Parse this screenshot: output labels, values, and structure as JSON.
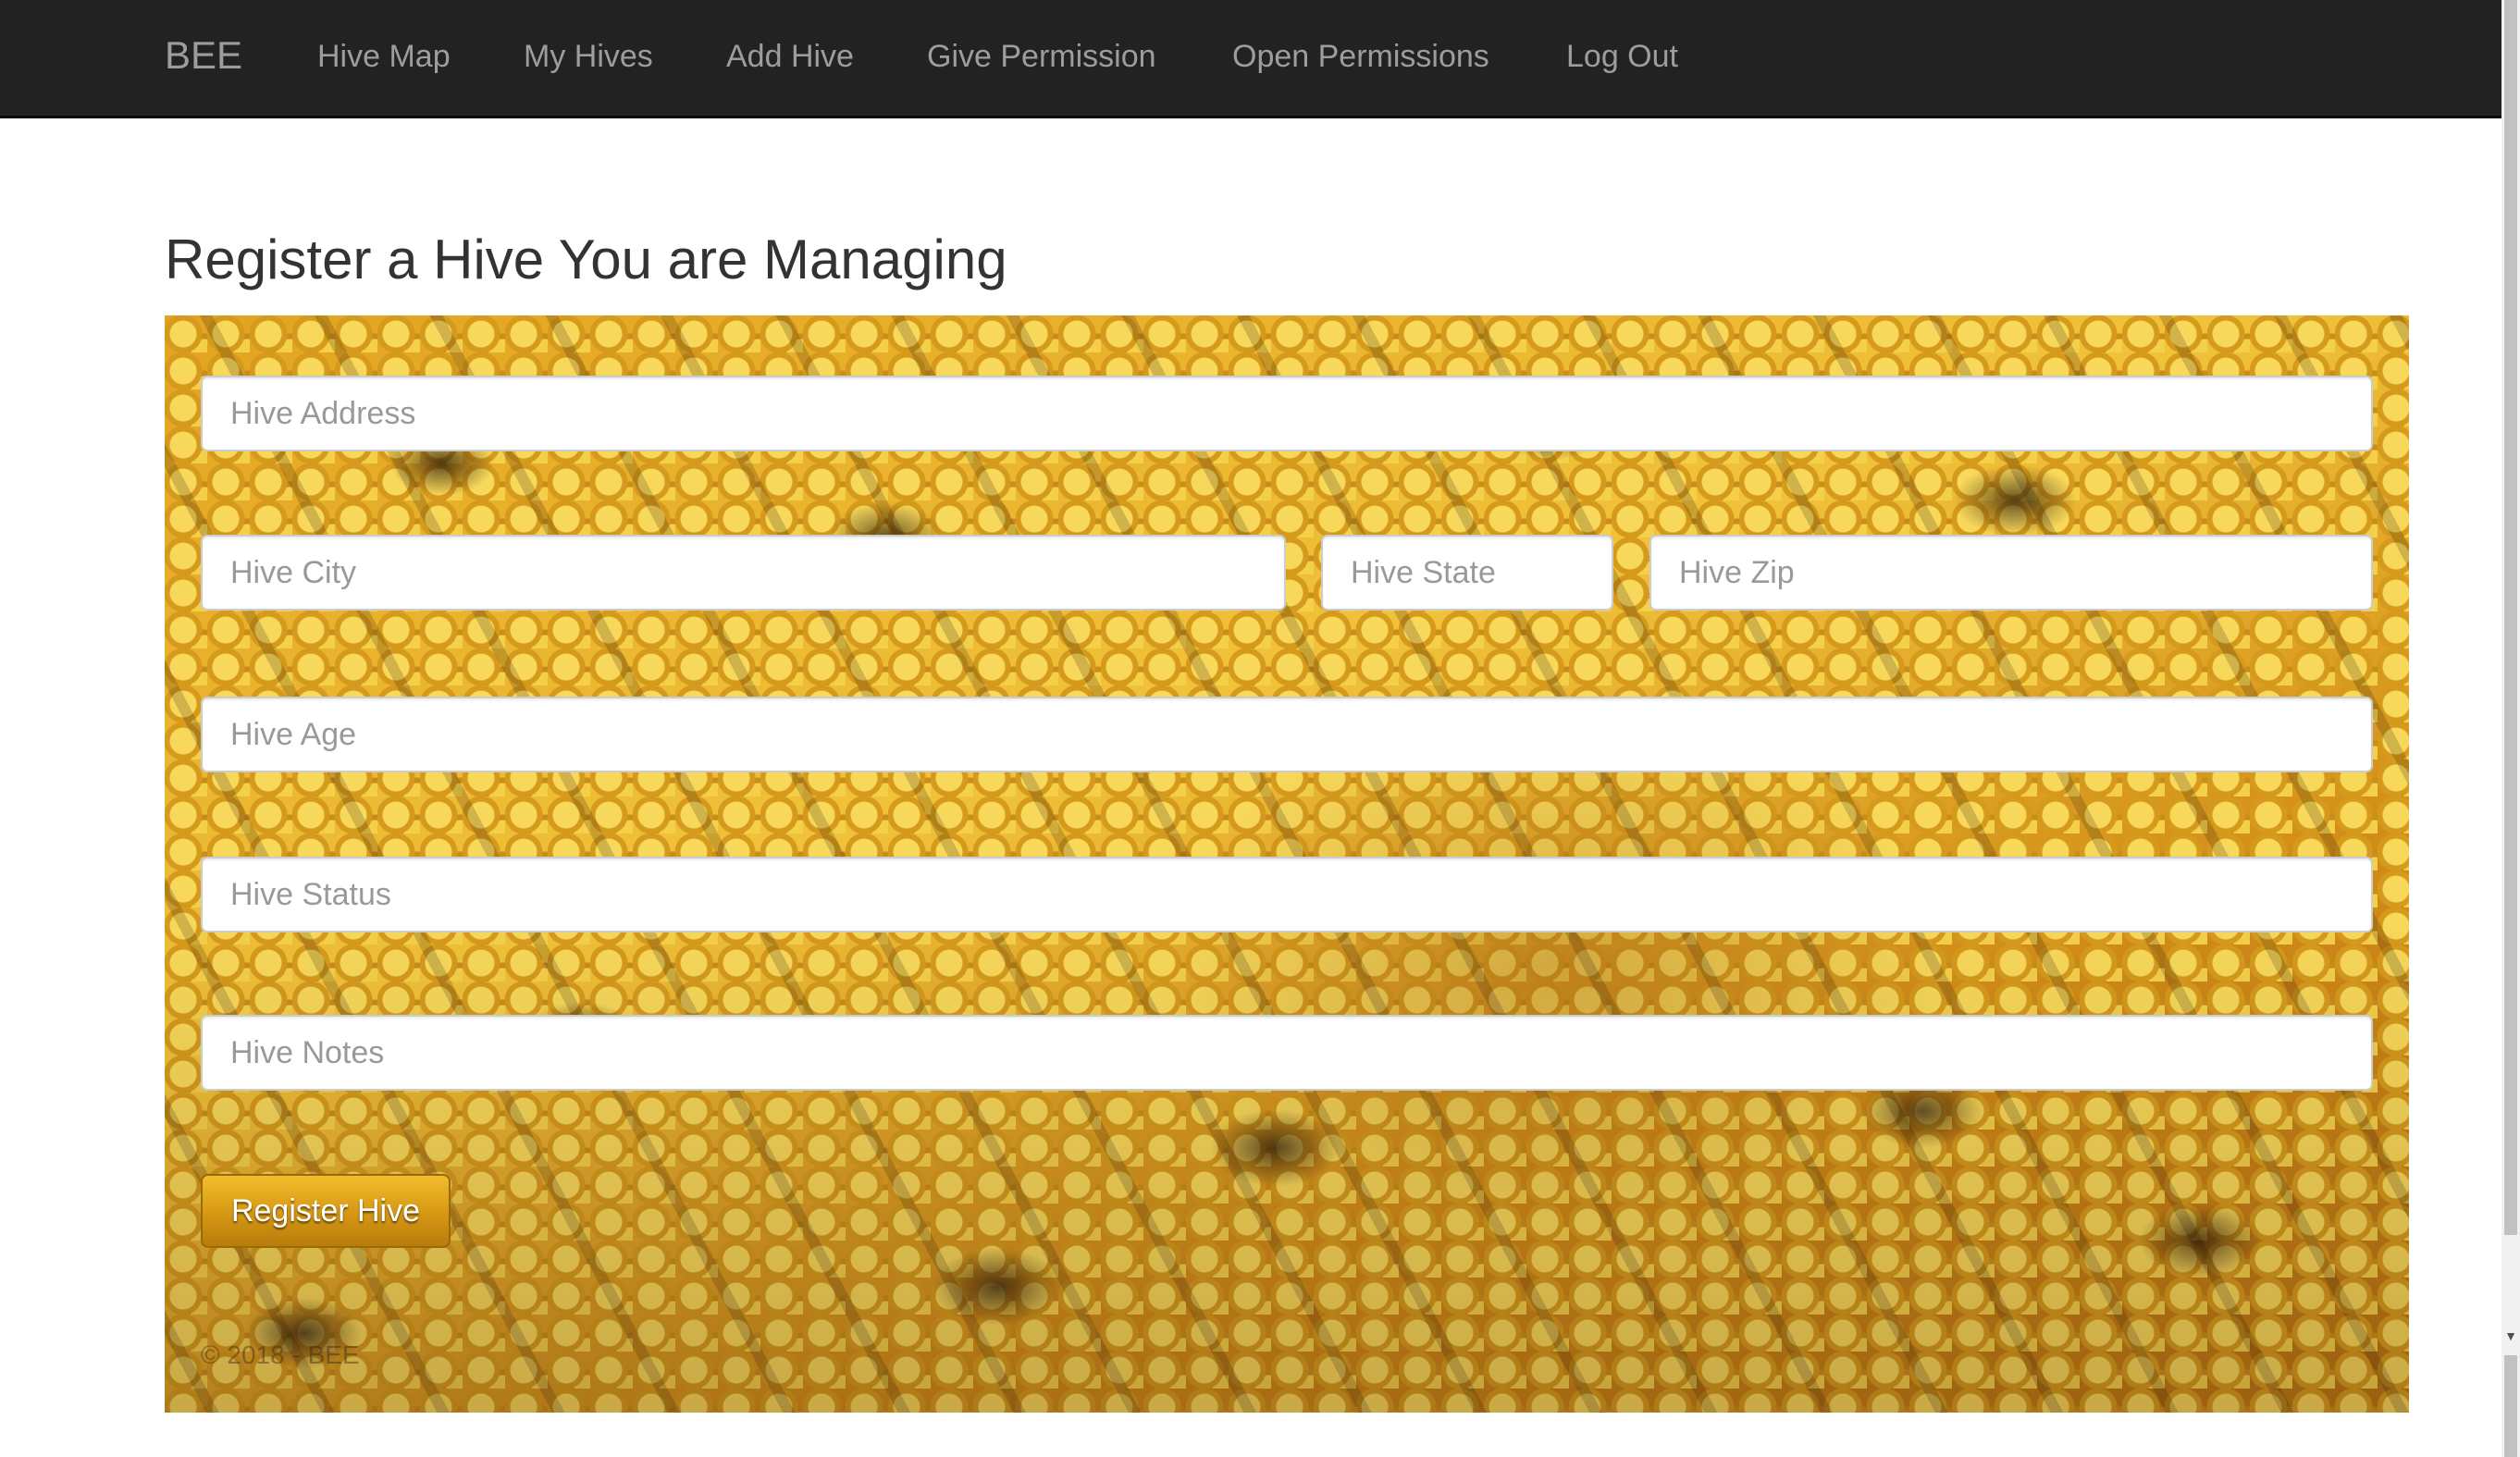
{
  "navbar": {
    "brand": "BEE",
    "items": [
      {
        "label": "Hive Map"
      },
      {
        "label": "My Hives"
      },
      {
        "label": "Add Hive"
      },
      {
        "label": "Give Permission"
      },
      {
        "label": "Open Permissions"
      },
      {
        "label": "Log Out"
      }
    ]
  },
  "page": {
    "title": "Register a Hive You are Managing"
  },
  "form": {
    "address": {
      "placeholder": "Hive Address",
      "value": ""
    },
    "city": {
      "placeholder": "Hive City",
      "value": ""
    },
    "state": {
      "placeholder": "Hive State",
      "value": ""
    },
    "zip": {
      "placeholder": "Hive Zip",
      "value": ""
    },
    "age": {
      "placeholder": "Hive Age",
      "value": ""
    },
    "status": {
      "placeholder": "Hive Status",
      "value": ""
    },
    "notes": {
      "placeholder": "Hive Notes",
      "value": ""
    },
    "submit_label": "Register Hive"
  },
  "footer": {
    "copyright": "© 2018 - BEE"
  },
  "colors": {
    "navbar_bg": "#222222",
    "nav_text": "#9d9d9d",
    "button_gold": "#d99a16"
  },
  "background_image": "honeybees-on-honeycomb"
}
